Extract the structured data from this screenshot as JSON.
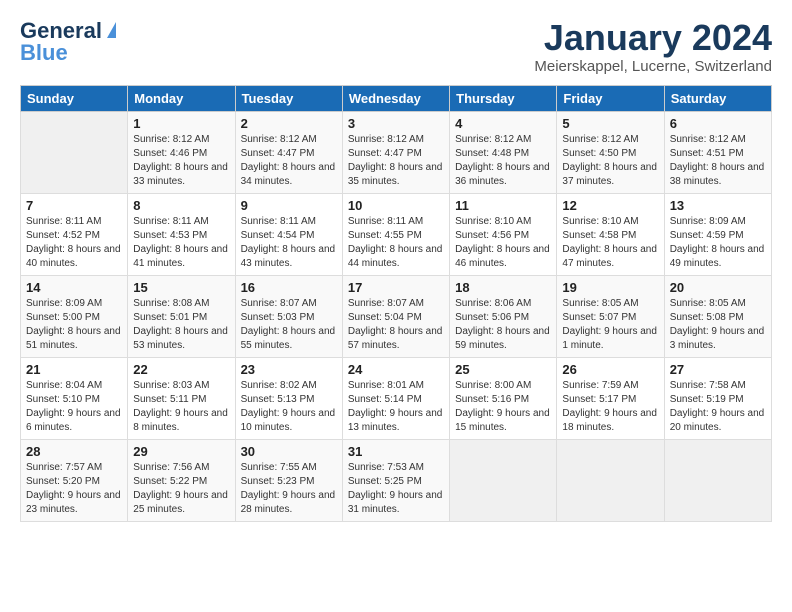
{
  "header": {
    "logo_line1": "General",
    "logo_line2": "Blue",
    "month_title": "January 2024",
    "location": "Meierskappel, Lucerne, Switzerland"
  },
  "weekdays": [
    "Sunday",
    "Monday",
    "Tuesday",
    "Wednesday",
    "Thursday",
    "Friday",
    "Saturday"
  ],
  "weeks": [
    [
      {
        "day": "",
        "sunrise": "",
        "sunset": "",
        "daylight": ""
      },
      {
        "day": "1",
        "sunrise": "Sunrise: 8:12 AM",
        "sunset": "Sunset: 4:46 PM",
        "daylight": "Daylight: 8 hours and 33 minutes."
      },
      {
        "day": "2",
        "sunrise": "Sunrise: 8:12 AM",
        "sunset": "Sunset: 4:47 PM",
        "daylight": "Daylight: 8 hours and 34 minutes."
      },
      {
        "day": "3",
        "sunrise": "Sunrise: 8:12 AM",
        "sunset": "Sunset: 4:47 PM",
        "daylight": "Daylight: 8 hours and 35 minutes."
      },
      {
        "day": "4",
        "sunrise": "Sunrise: 8:12 AM",
        "sunset": "Sunset: 4:48 PM",
        "daylight": "Daylight: 8 hours and 36 minutes."
      },
      {
        "day": "5",
        "sunrise": "Sunrise: 8:12 AM",
        "sunset": "Sunset: 4:50 PM",
        "daylight": "Daylight: 8 hours and 37 minutes."
      },
      {
        "day": "6",
        "sunrise": "Sunrise: 8:12 AM",
        "sunset": "Sunset: 4:51 PM",
        "daylight": "Daylight: 8 hours and 38 minutes."
      }
    ],
    [
      {
        "day": "7",
        "sunrise": "Sunrise: 8:11 AM",
        "sunset": "Sunset: 4:52 PM",
        "daylight": "Daylight: 8 hours and 40 minutes."
      },
      {
        "day": "8",
        "sunrise": "Sunrise: 8:11 AM",
        "sunset": "Sunset: 4:53 PM",
        "daylight": "Daylight: 8 hours and 41 minutes."
      },
      {
        "day": "9",
        "sunrise": "Sunrise: 8:11 AM",
        "sunset": "Sunset: 4:54 PM",
        "daylight": "Daylight: 8 hours and 43 minutes."
      },
      {
        "day": "10",
        "sunrise": "Sunrise: 8:11 AM",
        "sunset": "Sunset: 4:55 PM",
        "daylight": "Daylight: 8 hours and 44 minutes."
      },
      {
        "day": "11",
        "sunrise": "Sunrise: 8:10 AM",
        "sunset": "Sunset: 4:56 PM",
        "daylight": "Daylight: 8 hours and 46 minutes."
      },
      {
        "day": "12",
        "sunrise": "Sunrise: 8:10 AM",
        "sunset": "Sunset: 4:58 PM",
        "daylight": "Daylight: 8 hours and 47 minutes."
      },
      {
        "day": "13",
        "sunrise": "Sunrise: 8:09 AM",
        "sunset": "Sunset: 4:59 PM",
        "daylight": "Daylight: 8 hours and 49 minutes."
      }
    ],
    [
      {
        "day": "14",
        "sunrise": "Sunrise: 8:09 AM",
        "sunset": "Sunset: 5:00 PM",
        "daylight": "Daylight: 8 hours and 51 minutes."
      },
      {
        "day": "15",
        "sunrise": "Sunrise: 8:08 AM",
        "sunset": "Sunset: 5:01 PM",
        "daylight": "Daylight: 8 hours and 53 minutes."
      },
      {
        "day": "16",
        "sunrise": "Sunrise: 8:07 AM",
        "sunset": "Sunset: 5:03 PM",
        "daylight": "Daylight: 8 hours and 55 minutes."
      },
      {
        "day": "17",
        "sunrise": "Sunrise: 8:07 AM",
        "sunset": "Sunset: 5:04 PM",
        "daylight": "Daylight: 8 hours and 57 minutes."
      },
      {
        "day": "18",
        "sunrise": "Sunrise: 8:06 AM",
        "sunset": "Sunset: 5:06 PM",
        "daylight": "Daylight: 8 hours and 59 minutes."
      },
      {
        "day": "19",
        "sunrise": "Sunrise: 8:05 AM",
        "sunset": "Sunset: 5:07 PM",
        "daylight": "Daylight: 9 hours and 1 minute."
      },
      {
        "day": "20",
        "sunrise": "Sunrise: 8:05 AM",
        "sunset": "Sunset: 5:08 PM",
        "daylight": "Daylight: 9 hours and 3 minutes."
      }
    ],
    [
      {
        "day": "21",
        "sunrise": "Sunrise: 8:04 AM",
        "sunset": "Sunset: 5:10 PM",
        "daylight": "Daylight: 9 hours and 6 minutes."
      },
      {
        "day": "22",
        "sunrise": "Sunrise: 8:03 AM",
        "sunset": "Sunset: 5:11 PM",
        "daylight": "Daylight: 9 hours and 8 minutes."
      },
      {
        "day": "23",
        "sunrise": "Sunrise: 8:02 AM",
        "sunset": "Sunset: 5:13 PM",
        "daylight": "Daylight: 9 hours and 10 minutes."
      },
      {
        "day": "24",
        "sunrise": "Sunrise: 8:01 AM",
        "sunset": "Sunset: 5:14 PM",
        "daylight": "Daylight: 9 hours and 13 minutes."
      },
      {
        "day": "25",
        "sunrise": "Sunrise: 8:00 AM",
        "sunset": "Sunset: 5:16 PM",
        "daylight": "Daylight: 9 hours and 15 minutes."
      },
      {
        "day": "26",
        "sunrise": "Sunrise: 7:59 AM",
        "sunset": "Sunset: 5:17 PM",
        "daylight": "Daylight: 9 hours and 18 minutes."
      },
      {
        "day": "27",
        "sunrise": "Sunrise: 7:58 AM",
        "sunset": "Sunset: 5:19 PM",
        "daylight": "Daylight: 9 hours and 20 minutes."
      }
    ],
    [
      {
        "day": "28",
        "sunrise": "Sunrise: 7:57 AM",
        "sunset": "Sunset: 5:20 PM",
        "daylight": "Daylight: 9 hours and 23 minutes."
      },
      {
        "day": "29",
        "sunrise": "Sunrise: 7:56 AM",
        "sunset": "Sunset: 5:22 PM",
        "daylight": "Daylight: 9 hours and 25 minutes."
      },
      {
        "day": "30",
        "sunrise": "Sunrise: 7:55 AM",
        "sunset": "Sunset: 5:23 PM",
        "daylight": "Daylight: 9 hours and 28 minutes."
      },
      {
        "day": "31",
        "sunrise": "Sunrise: 7:53 AM",
        "sunset": "Sunset: 5:25 PM",
        "daylight": "Daylight: 9 hours and 31 minutes."
      },
      {
        "day": "",
        "sunrise": "",
        "sunset": "",
        "daylight": ""
      },
      {
        "day": "",
        "sunrise": "",
        "sunset": "",
        "daylight": ""
      },
      {
        "day": "",
        "sunrise": "",
        "sunset": "",
        "daylight": ""
      }
    ]
  ]
}
